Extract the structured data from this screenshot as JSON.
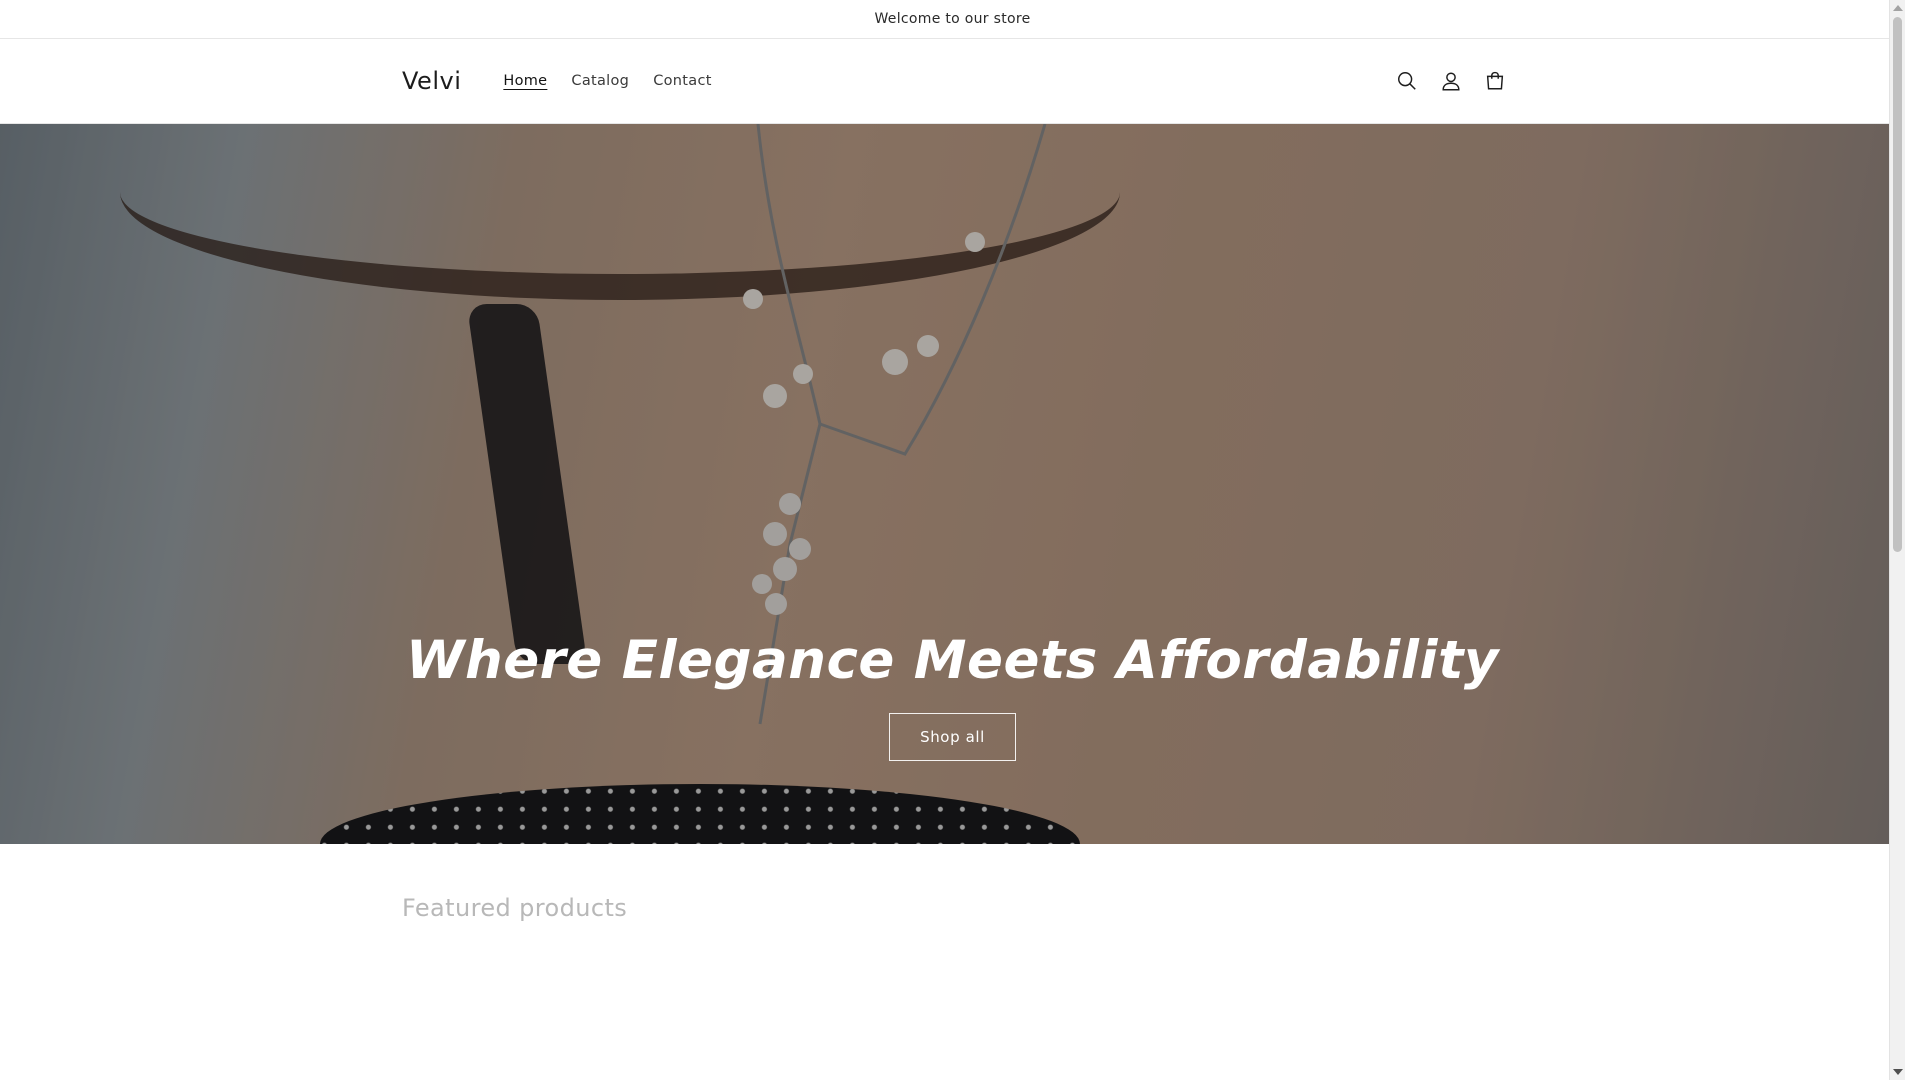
{
  "announcement": {
    "text": "Welcome to our store"
  },
  "header": {
    "logo": "Velvi",
    "nav": [
      {
        "label": "Home",
        "active": true
      },
      {
        "label": "Catalog",
        "active": false
      },
      {
        "label": "Contact",
        "active": false
      }
    ],
    "icons": [
      "search-icon",
      "account-icon",
      "cart-icon"
    ]
  },
  "hero": {
    "title": "Where Elegance Meets Affordability",
    "button_label": "Shop all"
  },
  "featured": {
    "title": "Featured products"
  },
  "colors": {
    "text": "#121212",
    "muted_heading": "#b8b8b8",
    "background": "#ffffff"
  }
}
